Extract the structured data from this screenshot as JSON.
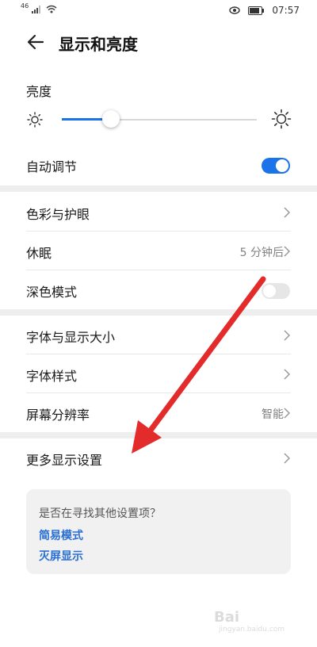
{
  "status_bar": {
    "signal_text": "46",
    "time": "07:57",
    "icons": [
      "signal-icon",
      "wifi-icon",
      "eye-comfort-icon",
      "battery-icon"
    ]
  },
  "header": {
    "title": "显示和亮度",
    "back_icon": "back-arrow-icon"
  },
  "brightness": {
    "label": "亮度",
    "level": 0.25,
    "auto_label": "自动调节",
    "auto_enabled": true
  },
  "groups": [
    [
      {
        "label": "色彩与护眼",
        "value": "",
        "chevron": true
      },
      {
        "label": "休眠",
        "value": "5 分钟后",
        "chevron": true
      },
      {
        "label": "深色模式",
        "value": "",
        "toggle": false
      }
    ],
    [
      {
        "label": "字体与显示大小",
        "value": "",
        "chevron": true
      },
      {
        "label": "字体样式",
        "value": "",
        "chevron": true
      },
      {
        "label": "屏幕分辨率",
        "value": "智能",
        "chevron": true
      }
    ],
    [
      {
        "label": "更多显示设置",
        "value": "",
        "chevron": true
      }
    ]
  ],
  "suggestion_card": {
    "question": "是否在寻找其他设置项？",
    "links": [
      "简易模式",
      "灭屏显示"
    ]
  },
  "watermark": {
    "text": "Bai",
    "sub": "jingyan.baidu.com"
  },
  "colors": {
    "accent": "#1a73e8",
    "annotation_arrow": "#e32b2b",
    "link": "#2a6fd6"
  }
}
